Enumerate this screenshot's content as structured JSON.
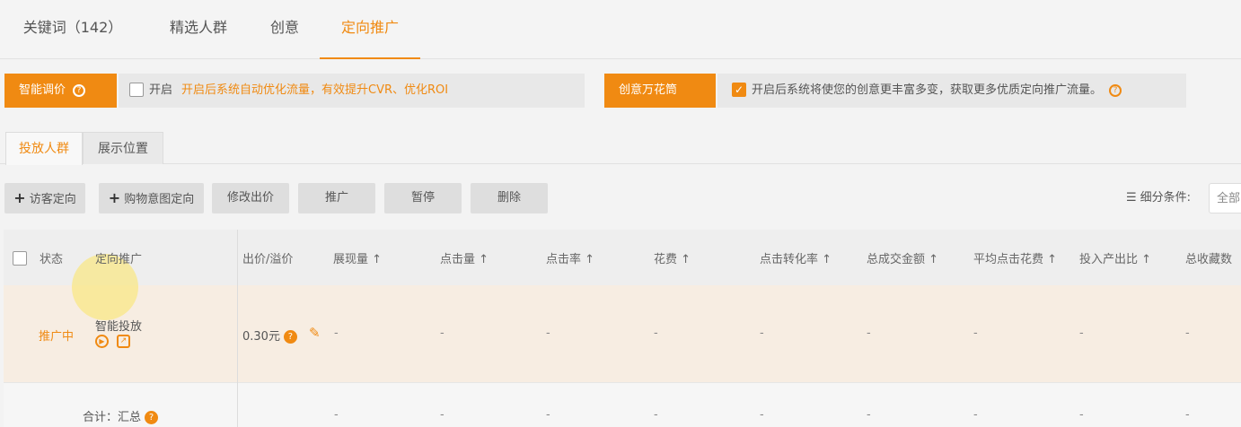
{
  "top_tabs": [
    "关键词（142）",
    "精选人群",
    "创意",
    "定向推广"
  ],
  "option_left": {
    "label": "智能调价",
    "checkbox_text": "开启",
    "desc": "开启后系统自动优化流量，有效提升CVR、优化ROI"
  },
  "option_right": {
    "label": "创意万花筒",
    "desc": "开启后系统将使您的创意更丰富多变，获取更多优质定向推广流量。"
  },
  "sub_tabs": [
    "投放人群",
    "展示位置"
  ],
  "toolbar": {
    "add_targeting": "访客定向",
    "add_tag": "购物意图定向",
    "batch_bid": "修改出价",
    "promote": "推广",
    "pause": "暂停",
    "delete": "删除",
    "filter_label": "细分条件:",
    "filter_value": "全部"
  },
  "table": {
    "headers": [
      "状态",
      "定向推广",
      "出价/溢价",
      "展现量 ↑",
      "点击量 ↑",
      "点击率 ↑",
      "花费 ↑",
      "点击转化率 ↑",
      "总成交金额 ↑",
      "平均点击花费 ↑",
      "投入产出比 ↑",
      "总收藏数"
    ],
    "row": {
      "status": "推广中",
      "name": "智能投放",
      "bid": "0.30元",
      "dash": "-"
    },
    "summary": "合计：汇总"
  },
  "colors": {
    "accent": "#f08a12"
  }
}
